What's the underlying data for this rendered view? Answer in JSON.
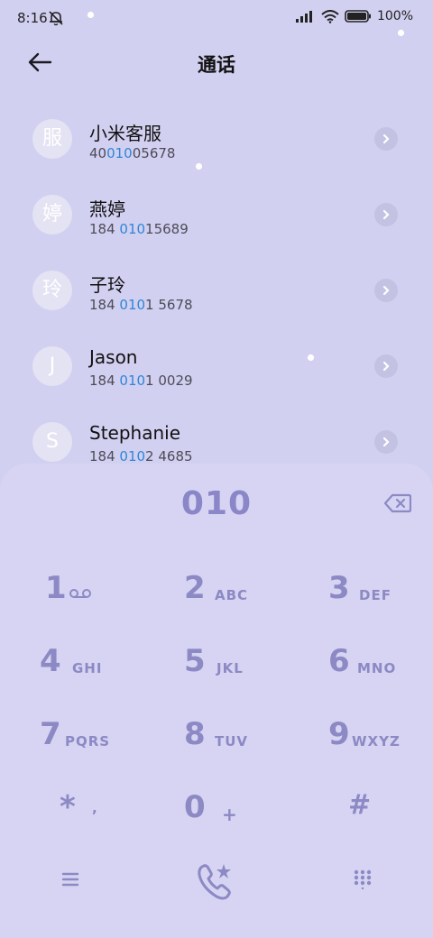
{
  "status_bar": {
    "time": "8:16",
    "battery": "100%"
  },
  "header": {
    "title": "通话"
  },
  "contacts": [
    {
      "avatar": "服",
      "name": "小米客服",
      "num_pre": "40",
      "num_hl": "010",
      "num_post": "05678"
    },
    {
      "avatar": "婷",
      "name": "燕婷",
      "num_pre": "184 ",
      "num_hl": "010",
      "num_post": "15689"
    },
    {
      "avatar": "玲",
      "name": "子玲",
      "num_pre": "184 ",
      "num_hl": "010",
      "num_post": "1 5678"
    },
    {
      "avatar": "J",
      "name": "Jason",
      "num_pre": "184 ",
      "num_hl": "010",
      "num_post": "1 0029"
    },
    {
      "avatar": "S",
      "name": "Stephanie",
      "num_pre": "184 ",
      "num_hl": "010",
      "num_post": "2 4685"
    }
  ],
  "dialer": {
    "entered": "010",
    "keys": [
      {
        "num": "1",
        "letters": ""
      },
      {
        "num": "2",
        "letters": "ABC"
      },
      {
        "num": "3",
        "letters": "DEF"
      },
      {
        "num": "4",
        "letters": "GHI"
      },
      {
        "num": "5",
        "letters": "JKL"
      },
      {
        "num": "6",
        "letters": "MNO"
      },
      {
        "num": "7",
        "letters": "PQRS"
      },
      {
        "num": "8",
        "letters": "TUV"
      },
      {
        "num": "9",
        "letters": "WXYZ"
      },
      {
        "num": "*",
        "letters": ","
      },
      {
        "num": "0",
        "letters": "+"
      },
      {
        "num": "#",
        "letters": ""
      }
    ]
  },
  "icons": {
    "back": "arrow-left-icon",
    "chevron": "chevron-right-icon",
    "backspace": "backspace-icon",
    "voicemail": "voicemail-icon",
    "menu": "menu-icon",
    "call": "phone-call-icon",
    "keypad_toggle": "keypad-grid-icon"
  },
  "colors": {
    "background": "#d2d0f0",
    "accent": "#8c89c4",
    "highlight": "#2f86d6"
  }
}
